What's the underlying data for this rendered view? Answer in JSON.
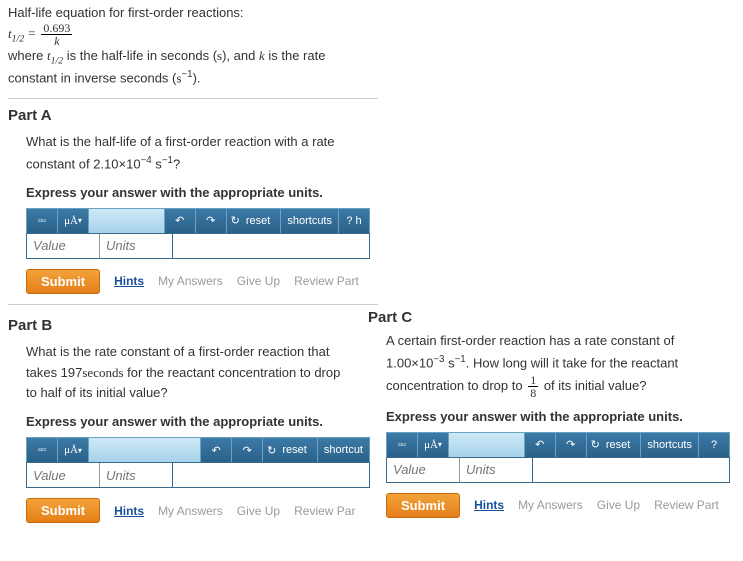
{
  "intro": {
    "line1": "Half-life equation for first-order reactions:",
    "eq_lhs_base": "t",
    "eq_lhs_sub": "1/2",
    "eq_eq": " = ",
    "eq_frac_num": "0.693",
    "eq_frac_den": "k",
    "line3a": "where ",
    "t": "t",
    "tsub": "1/2",
    "line3b": " is the half-life in seconds (",
    "s": "s",
    "line3c": "), and ",
    "k": "k",
    "line3d": " is the rate",
    "line4a": "constant in inverse seconds (",
    "s2": "s",
    "sup_neg1": "−1",
    "line4b": ")."
  },
  "parts": {
    "A": {
      "title": "Part A",
      "q1": "What is the half-life of a first-order reaction with a rate",
      "q2a": "constant of 2.10×10",
      "q2exp": "−4",
      "q2b": "  s",
      "q2exp2": "−1",
      "q2c": "?",
      "instr": "Express your answer with the appropriate units."
    },
    "B": {
      "title": "Part B",
      "q1": "What is the rate constant of a first-order reaction that",
      "q2a": "takes 197",
      "q2unit": "seconds",
      "q2b": " for the reactant concentration to drop",
      "q3": "to half of its initial value?",
      "instr": "Express your answer with the appropriate units."
    },
    "C": {
      "title": "Part C",
      "q1": "A certain first-order reaction has a rate constant of",
      "q2a": "1.00×10",
      "q2exp": "−3",
      "q2b": " s",
      "q2exp2": "−1",
      "q2c": ". How long will it take for the reactant",
      "q3a": "concentration to drop to ",
      "frac_num": "1",
      "frac_den": "8",
      "q3b": " of its initial value?",
      "instr": "Express your answer with the appropriate units."
    }
  },
  "toolbar": {
    "templates_icon": "▫▫",
    "mu": "μÅ",
    "undo": "↶",
    "redo": "↷",
    "refresh": "↻",
    "reset": "reset",
    "shortcuts": "shortcuts",
    "shortcut_cut": "shortcut",
    "help": "?",
    "help_h": "? h"
  },
  "inputs": {
    "value_ph": "Value",
    "units_ph": "Units"
  },
  "actions": {
    "submit": "Submit",
    "hints": "Hints",
    "my_answers": "My Answers",
    "give_up": "Give Up",
    "review": "Review Part",
    "review_cut": "Review Par"
  }
}
